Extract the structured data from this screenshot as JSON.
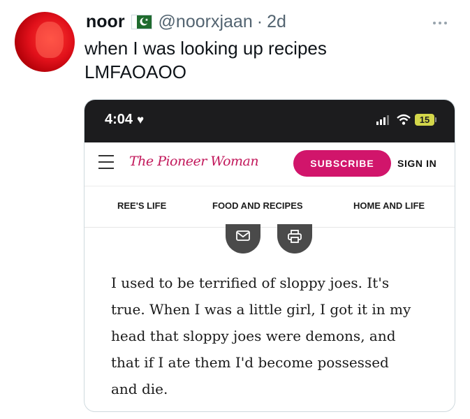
{
  "tweet": {
    "display_name": "noor",
    "handle": "@noorxjaan",
    "separator": "·",
    "time": "2d",
    "text_lines": [
      "when I was looking up recipes",
      "LMFAOAOO"
    ],
    "icons": {
      "avatar": "profile-avatar",
      "flag": "pakistan-flag-emoji",
      "more": "more-horizontal-icon"
    }
  },
  "screenshot": {
    "status_bar": {
      "clock": "4:04",
      "battery": "15",
      "icons": [
        "heart-icon",
        "signal-icon",
        "wifi-icon",
        "battery-icon"
      ]
    },
    "site": {
      "logo": "The Pioneer Woman",
      "subscribe_label": "SUBSCRIBE",
      "signin_label": "SIGN IN",
      "nav": [
        "REE'S LIFE",
        "FOOD AND RECIPES",
        "HOME AND LIFE"
      ],
      "share_icons": [
        "email-icon",
        "print-icon"
      ]
    },
    "article_lines": [
      "I used to be terrified of sloppy joes. It's",
      "true. When I was a little girl, I got it in my",
      "head that sloppy joes were demons, and",
      "that if I ate them I'd become possessed",
      "and die."
    ]
  },
  "colors": {
    "subscribe": "#d1156b",
    "logo": "#c2185b",
    "status_bar": "#1c1c1e",
    "muted_text": "#536471"
  }
}
